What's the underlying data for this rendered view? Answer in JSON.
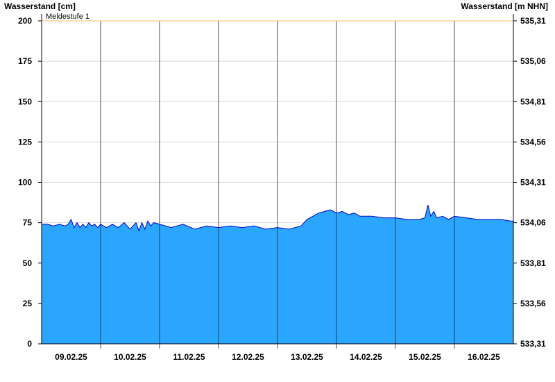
{
  "chart_data": {
    "type": "area",
    "ylabel_left": "Wasserstand [cm]",
    "ylabel_right": "Wasserstand [m NHN]",
    "ylim": [
      0,
      200
    ],
    "yticks_left": [
      "0",
      "25",
      "50",
      "75",
      "100",
      "125",
      "150",
      "175",
      "200"
    ],
    "yticks_right": [
      "533,31",
      "533,56",
      "533,81",
      "534,06",
      "534,31",
      "534,56",
      "534,81",
      "535,06",
      "535,31"
    ],
    "x_tick_labels": [
      "09.02.25",
      "10.02.25",
      "11.02.25",
      "12.02.25",
      "13.02.25",
      "14.02.25",
      "15.02.25",
      "16.02.25"
    ],
    "x_range_days": [
      0,
      8
    ],
    "reference_line": {
      "label": "Meldestufe 1",
      "value": 200,
      "color": "#f5c060"
    },
    "fill_color": "#2aa6ff",
    "line_color": "#0000cc",
    "grid": true,
    "series": [
      {
        "x": [
          0,
          0.1,
          0.2,
          0.3,
          0.4,
          0.45,
          0.5,
          0.55,
          0.6,
          0.65,
          0.7,
          0.75,
          0.8,
          0.85,
          0.9,
          0.95,
          1.0,
          1.1,
          1.2,
          1.3,
          1.4,
          1.5,
          1.6,
          1.65,
          1.7,
          1.75,
          1.8,
          1.85,
          1.9,
          2.0,
          2.2,
          2.4,
          2.6,
          2.8,
          3.0,
          3.2,
          3.4,
          3.6,
          3.8,
          4.0,
          4.2,
          4.4,
          4.5,
          4.6,
          4.7,
          4.8,
          4.9,
          5.0,
          5.1,
          5.2,
          5.3,
          5.4,
          5.5,
          5.6,
          5.8,
          6.0,
          6.2,
          6.4,
          6.5,
          6.55,
          6.6,
          6.65,
          6.7,
          6.8,
          6.9,
          7.0,
          7.2,
          7.4,
          7.6,
          7.8,
          7.95,
          8.0
        ],
        "values": [
          74,
          74,
          73,
          74,
          73,
          74,
          77,
          72,
          75,
          72,
          74,
          72,
          75,
          73,
          74,
          72,
          74,
          72,
          74,
          72,
          75,
          71,
          75,
          70,
          75,
          71,
          76,
          73,
          75,
          74,
          72,
          74,
          71,
          73,
          72,
          73,
          72,
          73,
          71,
          72,
          71,
          73,
          77,
          79,
          81,
          82,
          83,
          81,
          82,
          80,
          81,
          79,
          79,
          79,
          78,
          78,
          77,
          77,
          78,
          86,
          79,
          82,
          78,
          79,
          77,
          79,
          78,
          77,
          77,
          77,
          76,
          76
        ]
      }
    ]
  }
}
